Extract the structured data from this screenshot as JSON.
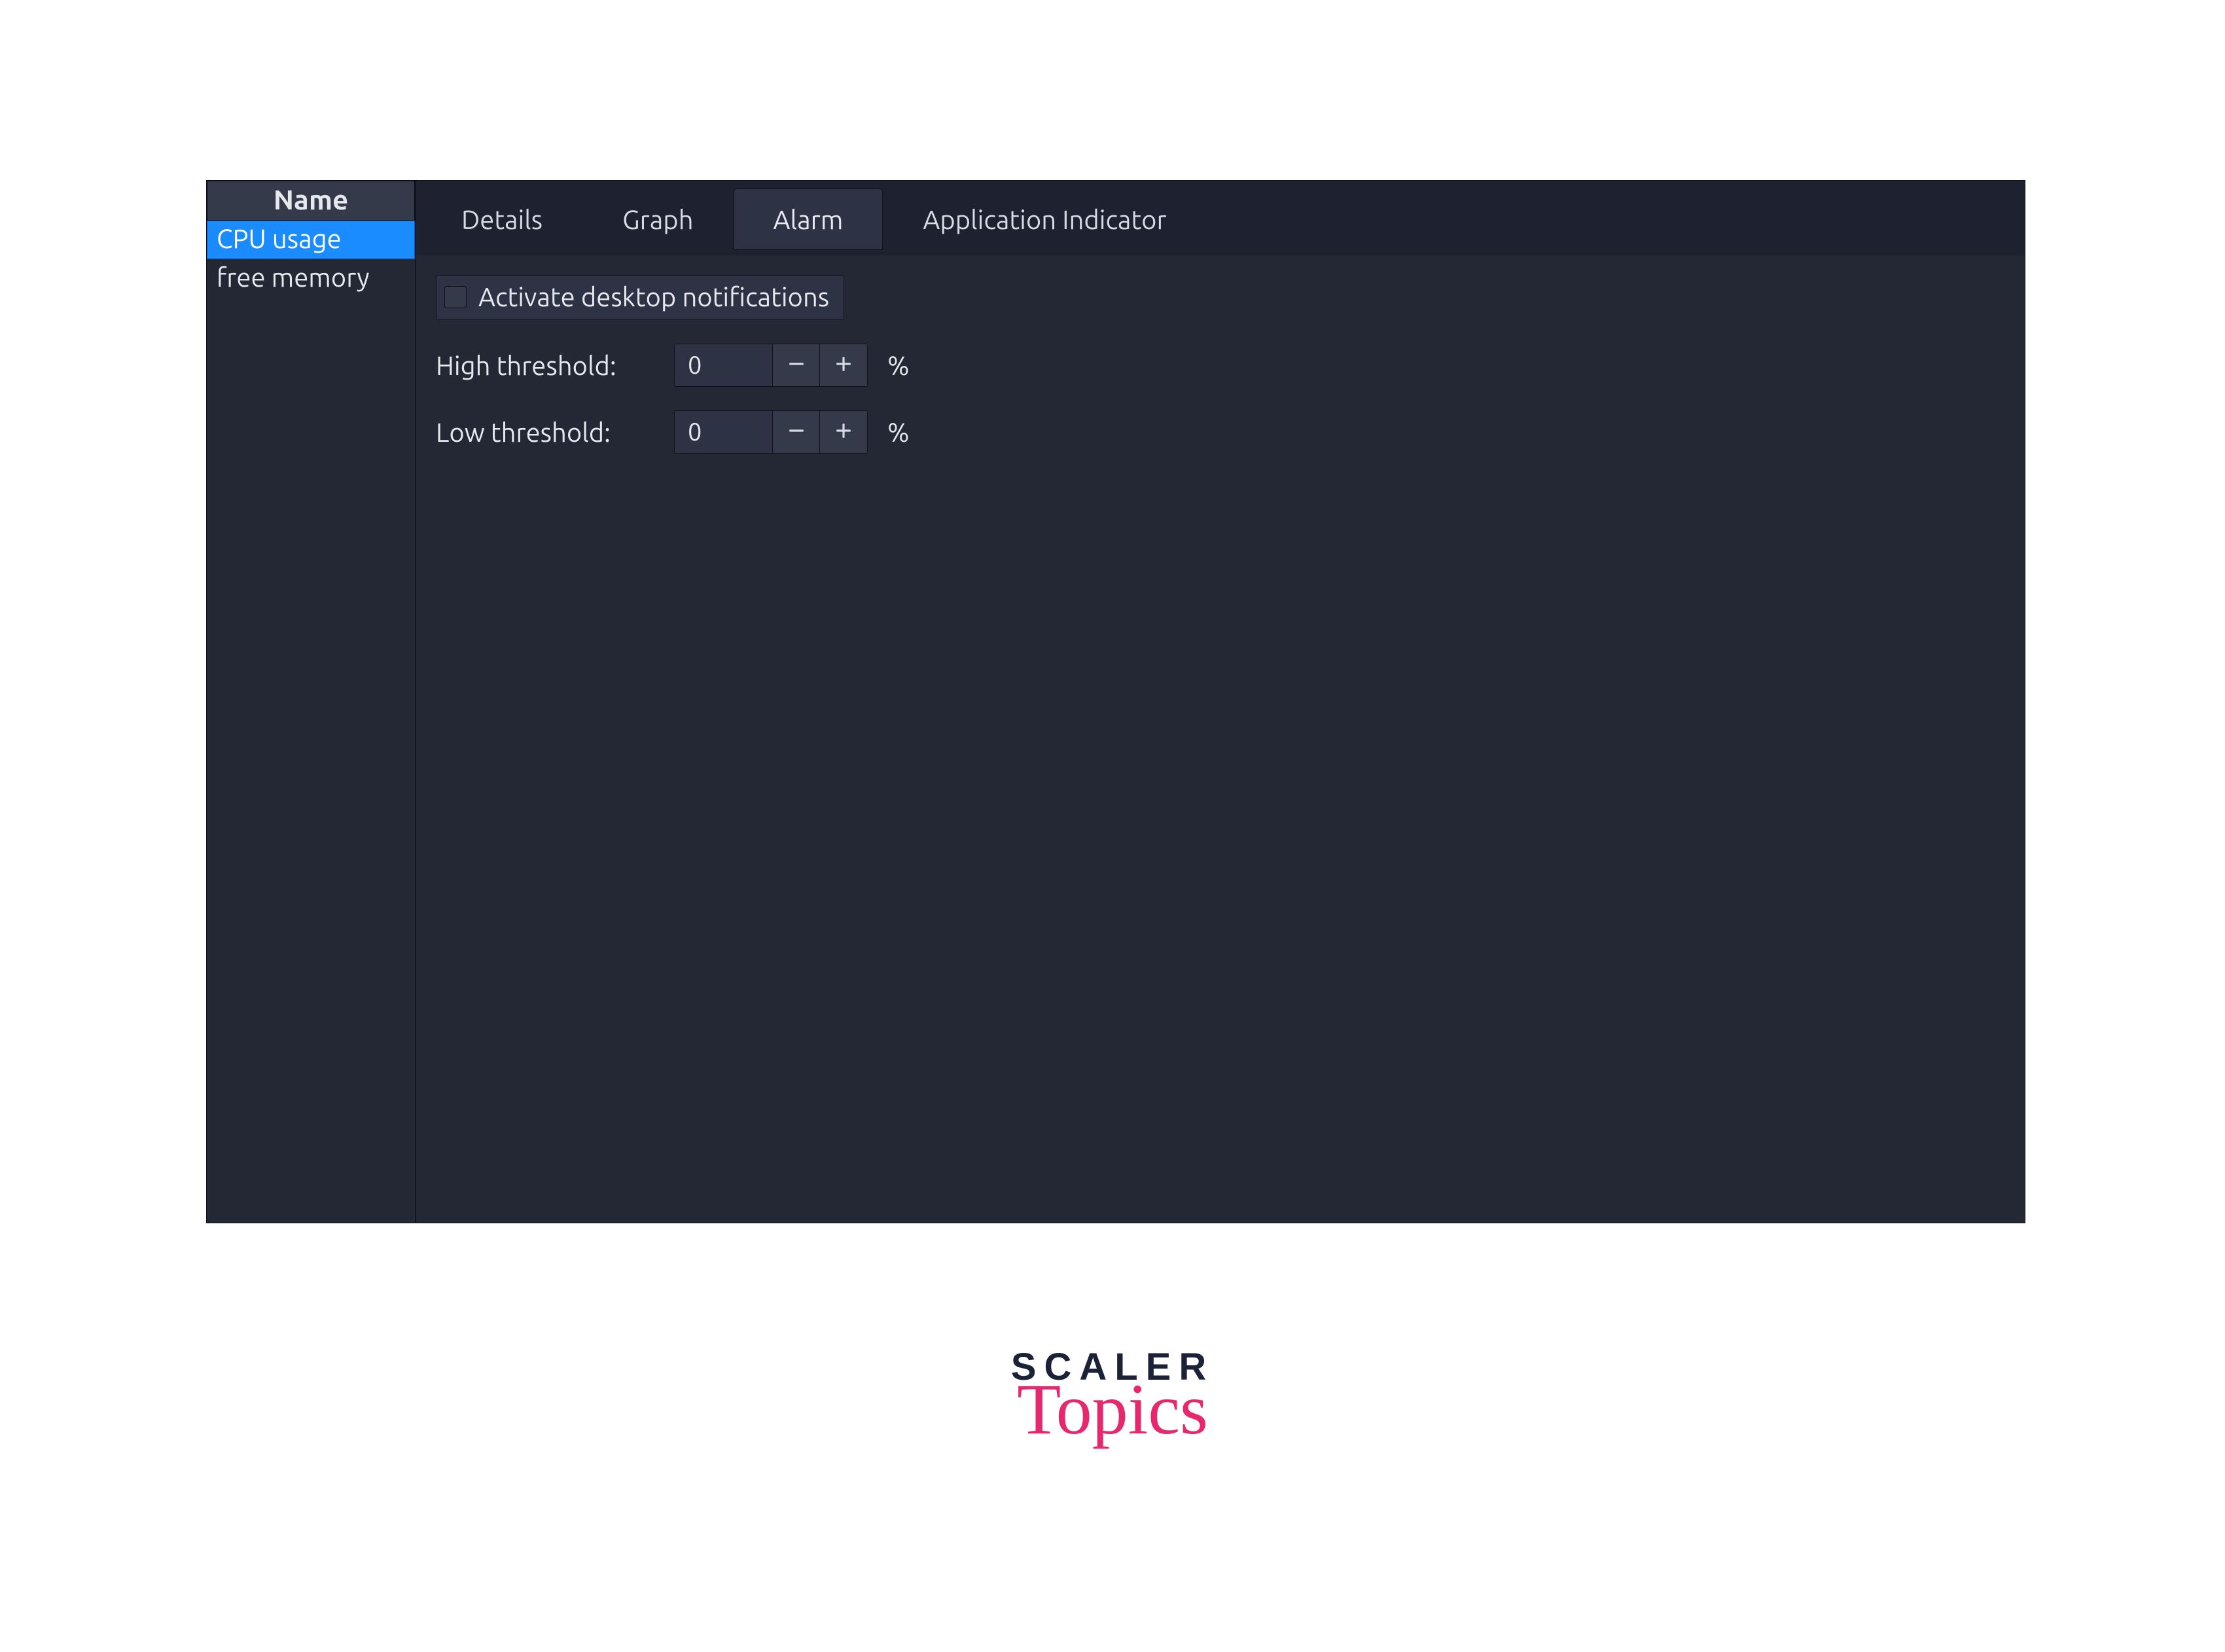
{
  "sidebar": {
    "header": "Name",
    "items": [
      {
        "label": "CPU usage",
        "selected": true
      },
      {
        "label": "free memory",
        "selected": false
      }
    ]
  },
  "tabs": [
    {
      "id": "details",
      "label": "Details",
      "active": false
    },
    {
      "id": "graph",
      "label": "Graph",
      "active": false
    },
    {
      "id": "alarm",
      "label": "Alarm",
      "active": true
    },
    {
      "id": "appind",
      "label": "Application Indicator",
      "active": false
    }
  ],
  "alarm": {
    "activate_label": "Activate desktop notifications",
    "activate_checked": false,
    "high_label": "High threshold:",
    "high_value": "0",
    "high_unit": "%",
    "low_label": "Low threshold:",
    "low_value": "0",
    "low_unit": "%"
  },
  "branding": {
    "line1": "SCALER",
    "line2": "Topics"
  },
  "colors": {
    "panel_bg": "#242835",
    "header_bg": "#343a4a",
    "selection": "#1a8cff",
    "accent": "#e6286e",
    "text": "#e6e8ee"
  }
}
